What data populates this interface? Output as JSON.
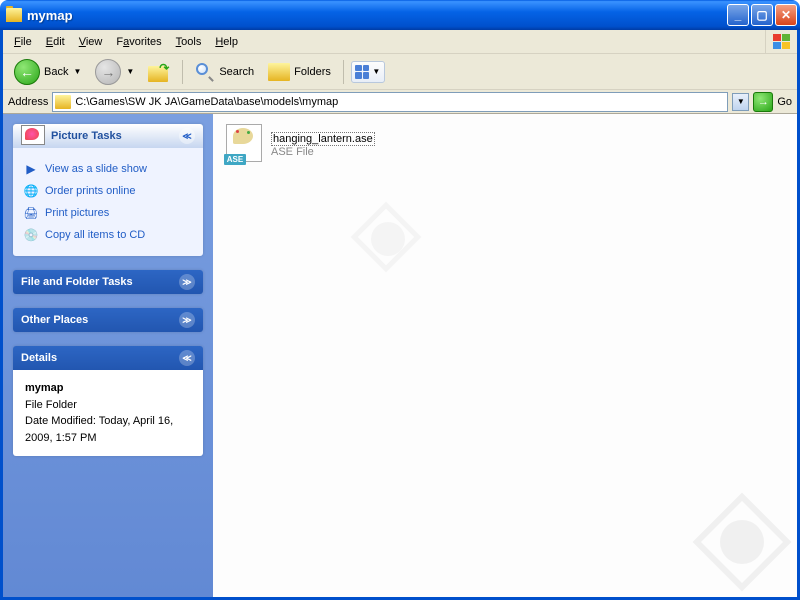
{
  "titlebar": {
    "title": "mymap"
  },
  "menu": {
    "file": "File",
    "edit": "Edit",
    "view": "View",
    "favorites": "Favorites",
    "tools": "Tools",
    "help": "Help"
  },
  "toolbar": {
    "back": "Back",
    "search": "Search",
    "folders": "Folders"
  },
  "address": {
    "label": "Address",
    "path": "C:\\Games\\SW JK JA\\GameData\\base\\models\\mymap",
    "go": "Go"
  },
  "sidebar": {
    "picture_tasks": {
      "title": "Picture Tasks",
      "items": [
        {
          "label": "View as a slide show"
        },
        {
          "label": "Order prints online"
        },
        {
          "label": "Print pictures"
        },
        {
          "label": "Copy all items to CD"
        }
      ]
    },
    "file_folder_tasks": {
      "title": "File and Folder Tasks"
    },
    "other_places": {
      "title": "Other Places"
    },
    "details": {
      "title": "Details",
      "name": "mymap",
      "type": "File Folder",
      "modified": "Date Modified: Today, April 16, 2009, 1:57 PM"
    }
  },
  "files": [
    {
      "name": "hanging_lantern.ase",
      "type": "ASE File",
      "badge": "ASE"
    }
  ]
}
